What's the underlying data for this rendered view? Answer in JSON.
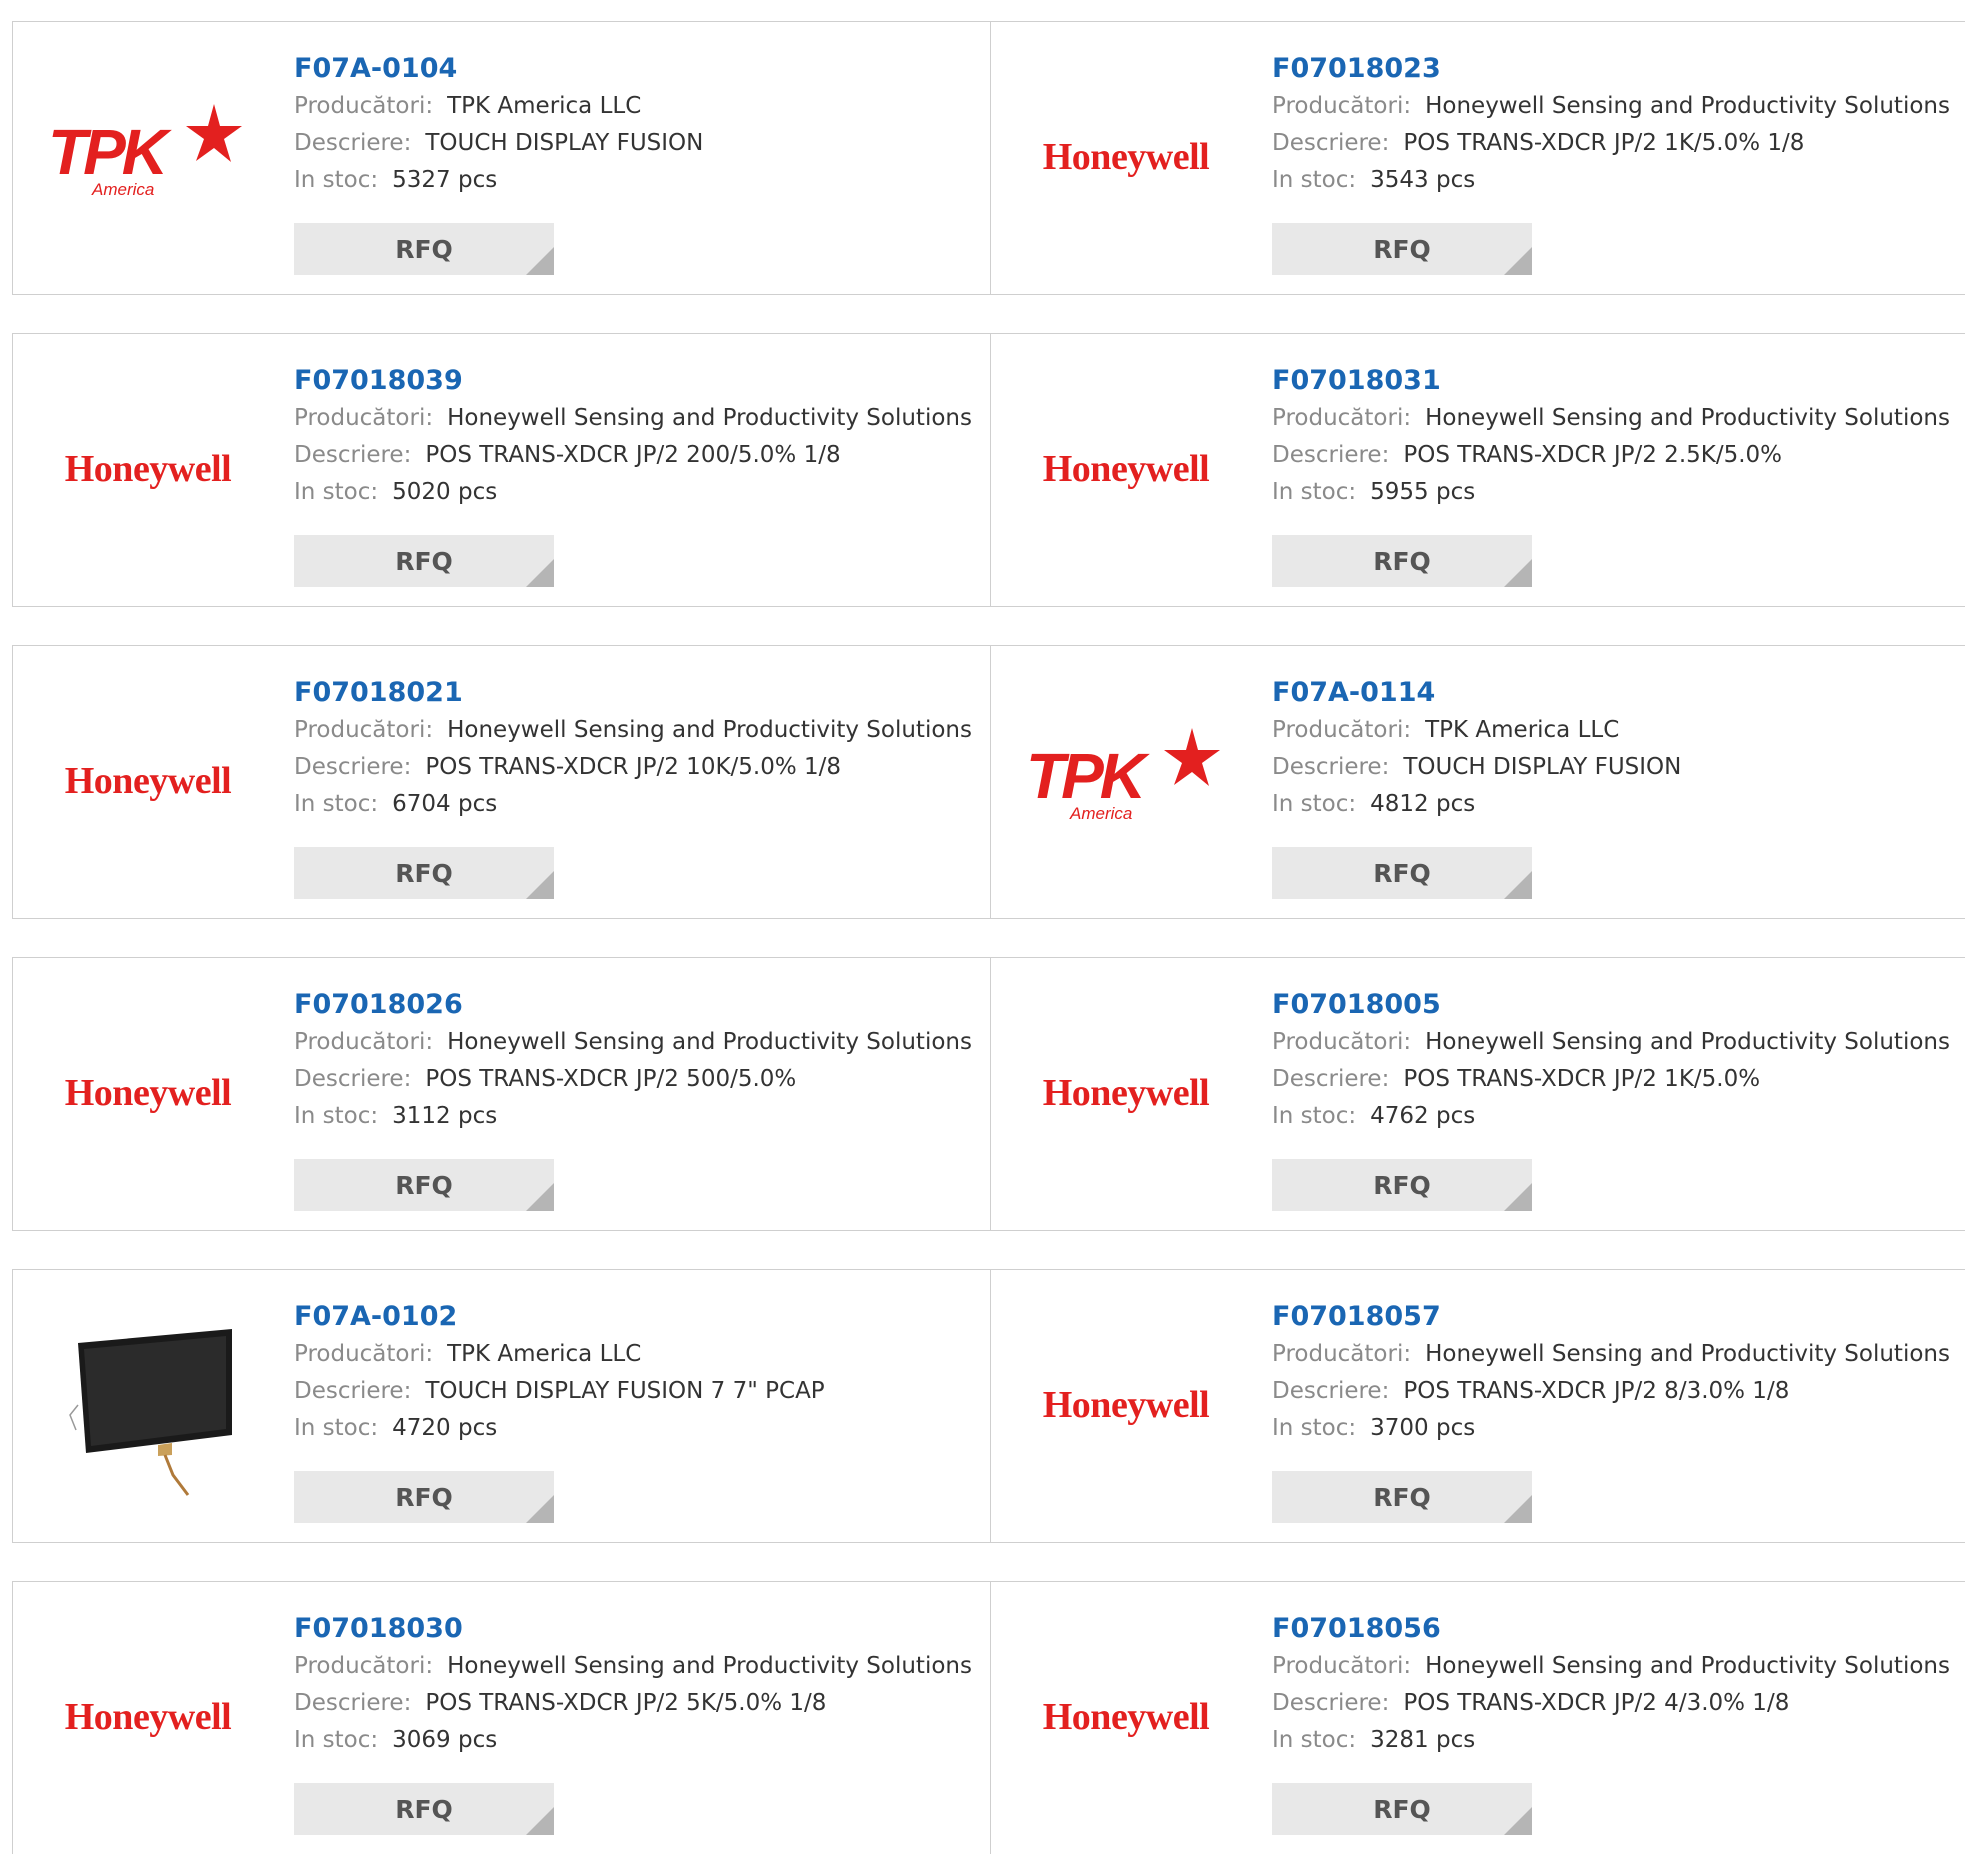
{
  "labels": {
    "manufacturer": "Producători:",
    "description": "Descriere:",
    "stock": "In stoc:"
  },
  "rfq_label": "RFQ",
  "logo_text": {
    "honeywell": "Honeywell",
    "tpk": "TPK",
    "tpk_sub": "America"
  },
  "colors": {
    "part_link": "#1a66b3",
    "logo_red": "#e3201f",
    "button_bg": "#e8e8e8"
  },
  "products": [
    {
      "part": "F07A-0104",
      "manufacturer": "TPK America LLC",
      "description": "TOUCH DISPLAY FUSION",
      "stock": "5327 pcs",
      "logo": "tpk"
    },
    {
      "part": "F07018023",
      "manufacturer": "Honeywell Sensing and Productivity Solutions",
      "description": "POS TRANS-XDCR JP/2 1K/5.0% 1/8",
      "stock": "3543 pcs",
      "logo": "honeywell"
    },
    {
      "part": "F07018039",
      "manufacturer": "Honeywell Sensing and Productivity Solutions",
      "description": "POS TRANS-XDCR JP/2 200/5.0% 1/8",
      "stock": "5020 pcs",
      "logo": "honeywell"
    },
    {
      "part": "F07018031",
      "manufacturer": "Honeywell Sensing and Productivity Solutions",
      "description": "POS TRANS-XDCR JP/2 2.5K/5.0%",
      "stock": "5955 pcs",
      "logo": "honeywell"
    },
    {
      "part": "F07018021",
      "manufacturer": "Honeywell Sensing and Productivity Solutions",
      "description": "POS TRANS-XDCR JP/2 10K/5.0% 1/8",
      "stock": "6704 pcs",
      "logo": "honeywell"
    },
    {
      "part": "F07A-0114",
      "manufacturer": "TPK America LLC",
      "description": "TOUCH DISPLAY FUSION",
      "stock": "4812 pcs",
      "logo": "tpk"
    },
    {
      "part": "F07018026",
      "manufacturer": "Honeywell Sensing and Productivity Solutions",
      "description": "POS TRANS-XDCR JP/2 500/5.0%",
      "stock": "3112 pcs",
      "logo": "honeywell"
    },
    {
      "part": "F07018005",
      "manufacturer": "Honeywell Sensing and Productivity Solutions",
      "description": "POS TRANS-XDCR JP/2 1K/5.0%",
      "stock": "4762 pcs",
      "logo": "honeywell"
    },
    {
      "part": "F07A-0102",
      "manufacturer": "TPK America LLC",
      "description": "TOUCH DISPLAY FUSION 7 7\" PCAP",
      "stock": "4720 pcs",
      "logo": "display-photo"
    },
    {
      "part": "F07018057",
      "manufacturer": "Honeywell Sensing and Productivity Solutions",
      "description": "POS TRANS-XDCR JP/2 8/3.0% 1/8",
      "stock": "3700 pcs",
      "logo": "honeywell"
    },
    {
      "part": "F07018030",
      "manufacturer": "Honeywell Sensing and Productivity Solutions",
      "description": "POS TRANS-XDCR JP/2 5K/5.0% 1/8",
      "stock": "3069 pcs",
      "logo": "honeywell"
    },
    {
      "part": "F07018056",
      "manufacturer": "Honeywell Sensing and Productivity Solutions",
      "description": "POS TRANS-XDCR JP/2 4/3.0% 1/8",
      "stock": "3281 pcs",
      "logo": "honeywell"
    }
  ]
}
